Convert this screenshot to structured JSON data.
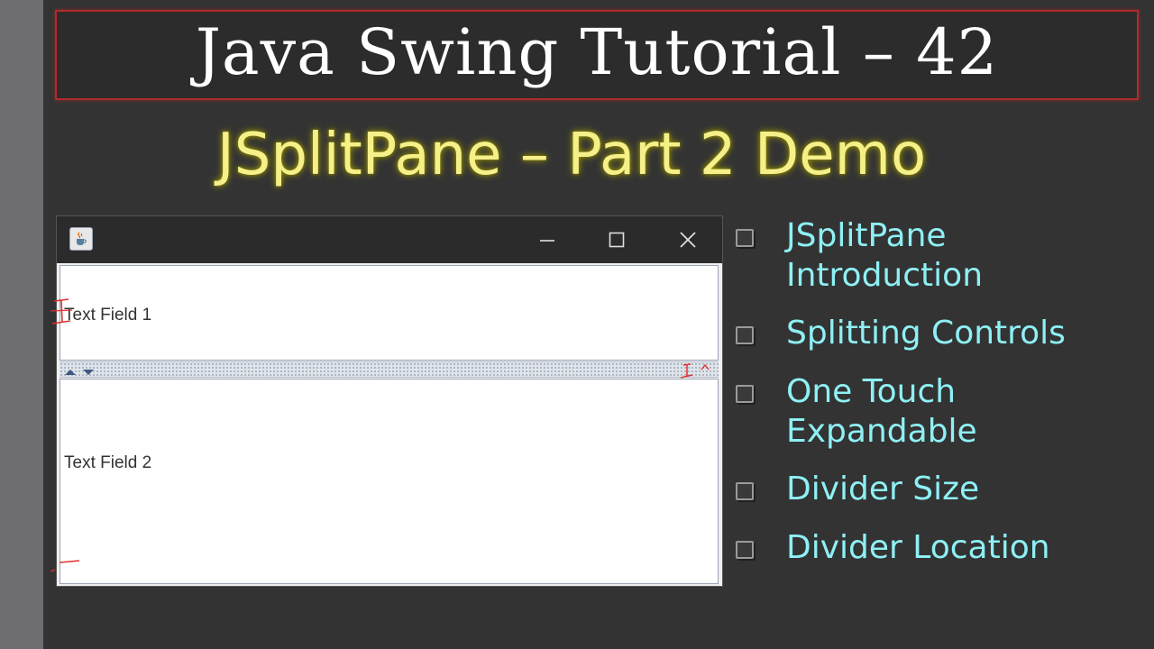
{
  "slide": {
    "title": "Java Swing Tutorial – 42",
    "subtitle": "JSplitPane – Part 2 Demo",
    "colors": {
      "background": "#333333",
      "title_border": "#b22a2a",
      "subtitle": "#f5f08a",
      "bullet_text": "#8ef0f4"
    }
  },
  "demo_window": {
    "icon": "java-coffee-cup-icon",
    "controls": {
      "minimize_icon": "minimize-icon",
      "maximize_icon": "maximize-icon",
      "close_icon": "close-icon"
    },
    "top_pane": {
      "text_field_label": "Text Field 1"
    },
    "divider": {
      "left_arrow_icon": "arrow-up-icon",
      "right_arrow_icon": "arrow-down-icon"
    },
    "bottom_pane": {
      "text_field_label": "Text Field 2"
    }
  },
  "bullets": [
    {
      "line1": "JSplitPane",
      "line2": "Introduction"
    },
    {
      "line1": "Splitting Controls",
      "line2": ""
    },
    {
      "line1": "One Touch",
      "line2": "Expandable"
    },
    {
      "line1": "Divider Size",
      "line2": ""
    },
    {
      "line1": "Divider Location",
      "line2": ""
    }
  ]
}
